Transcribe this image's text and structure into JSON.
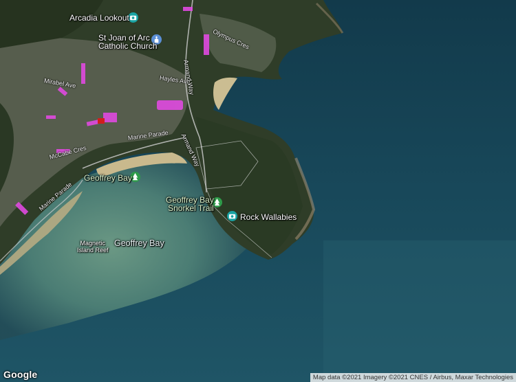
{
  "map": {
    "type": "satellite",
    "provider_logo": "Google",
    "attribution": "Map data ©2021 Imagery ©2021 CNES / Airbus, Maxar Technologies",
    "colors": {
      "deep_sea": "#143e4f",
      "shallow_water": "#5f8e7e",
      "land": "#2d3a26",
      "sand": "#c2b48a",
      "highlight": "#e040e0"
    },
    "places": [
      {
        "name": "Arcadia Lookout",
        "icon": "camera-icon",
        "pin_color": "#1aa3a3"
      },
      {
        "name": "St Joan of Arc Catholic Church",
        "line1": "St Joan of Arc",
        "line2": "Catholic Church",
        "icon": "church-icon",
        "pin_color": "#5b8fd6"
      },
      {
        "name": "Geoffrey Bay",
        "icon": "tree-icon",
        "pin_color": "#2e9b4a"
      },
      {
        "name": "Geoffrey Bay Snorkel Trail",
        "line1": "Geoffrey Bay",
        "line2": "Snorkel Trail",
        "icon": "tree-icon",
        "pin_color": "#2e9b4a"
      },
      {
        "name": "Rock Wallabies",
        "icon": "camera-icon",
        "pin_color": "#1aa3a3"
      }
    ],
    "area_labels": {
      "bay": "Geoffrey Bay",
      "reef_line1": "Magnetic",
      "reef_line2": "Island Reef"
    },
    "streets": [
      "Marine Parade",
      "Armand Way",
      "Olympus Cres",
      "Hayles Ave",
      "Mirabel Ave",
      "McCabe Cres",
      "Marine Parade",
      "Armand Way"
    ]
  }
}
